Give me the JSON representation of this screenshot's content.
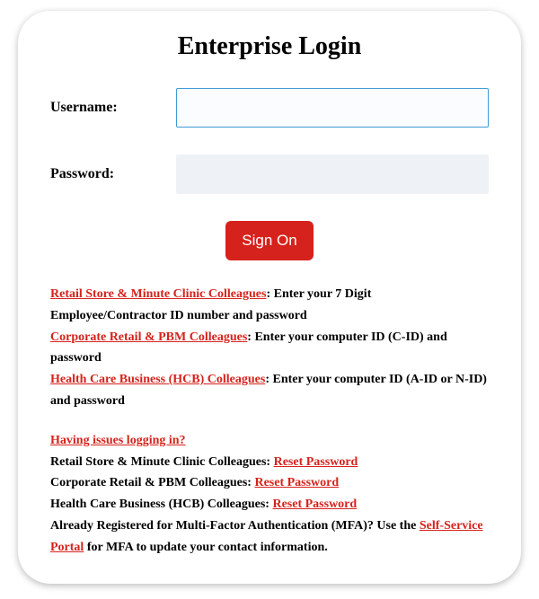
{
  "title": "Enterprise Login",
  "form": {
    "username_label": "Username:",
    "username_value": "",
    "password_label": "Password:",
    "password_value": "",
    "sign_on_label": "Sign On"
  },
  "info": {
    "group1": {
      "link": "Retail Store & Minute Clinic Colleagues",
      "text": ": Enter your 7 Digit Employee/Contractor ID number and password"
    },
    "group2": {
      "link": "Corporate Retail & PBM Colleagues",
      "text": ": Enter your computer ID (C-ID) and password"
    },
    "group3": {
      "link": "Health Care Business (HCB) Colleagues",
      "text": ": Enter your computer ID (A-ID or N-ID) and password"
    },
    "issues_link": "Having issues logging in?",
    "reset1_prefix": "Retail Store & Minute Clinic Colleagues: ",
    "reset1_link": "Reset Password",
    "reset2_prefix": "Corporate Retail & PBM Colleagues: ",
    "reset2_link": "Reset Password",
    "reset3_prefix": "Health Care Business (HCB) Colleagues: ",
    "reset3_link": "Reset Password",
    "mfa_prefix": "Already Registered for Multi-Factor Authentication (MFA)? Use the ",
    "mfa_link": "Self-Service Portal",
    "mfa_suffix": " for MFA to update your contact information."
  }
}
